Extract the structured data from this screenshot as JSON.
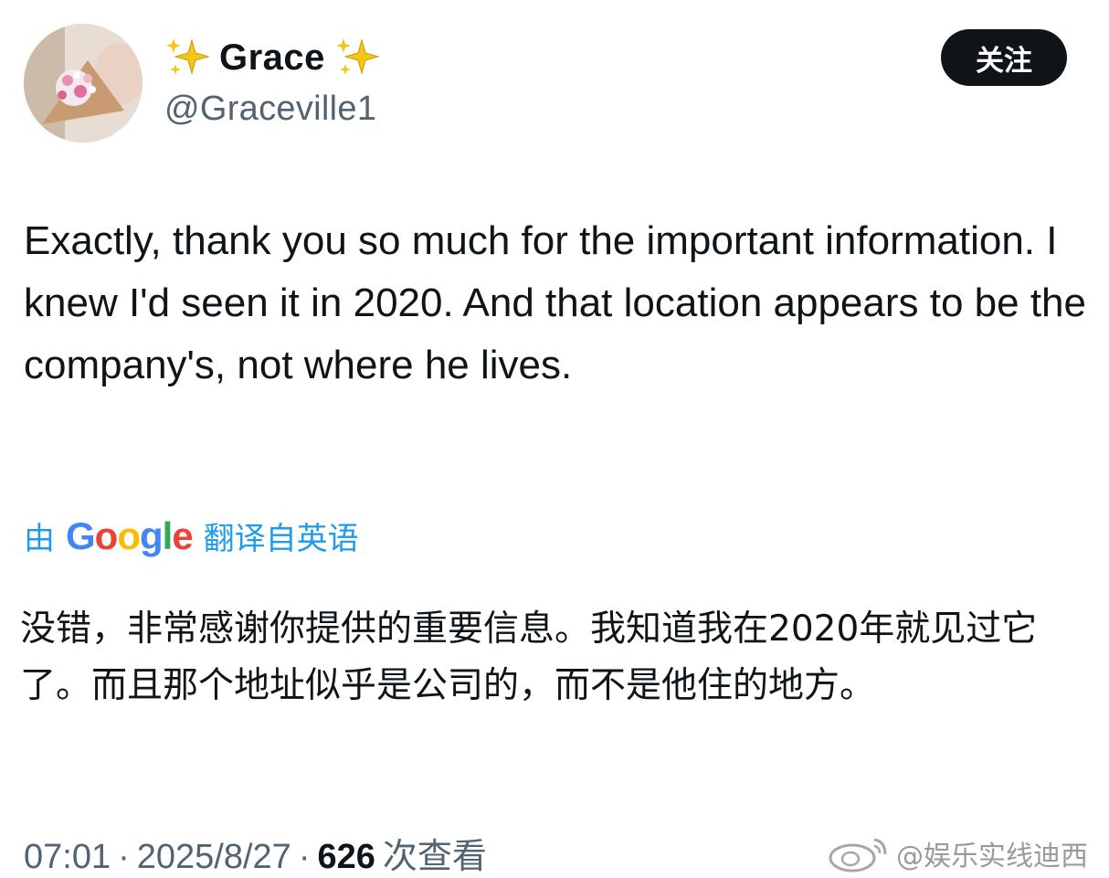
{
  "user": {
    "display_name": "Grace",
    "handle": "@Graceville1",
    "avatar_icon": "profile-photo-flowers"
  },
  "follow_button": {
    "label": "关注"
  },
  "tweet": {
    "text": "Exactly, thank you so much for the important information. I knew I'd seen it in 2020. And that location appears to be the company's, not where he lives."
  },
  "translation": {
    "by_label": "由",
    "provider_letters": [
      "G",
      "o",
      "o",
      "g",
      "l",
      "e"
    ],
    "from_label": "翻译自英语",
    "text": "没错，非常感谢你提供的重要信息。我知道我在2020年就见过它了。而且那个地址似乎是公司的，而不是他住的地方。"
  },
  "meta": {
    "time": "07:01",
    "separator": "·",
    "date": "2025/8/27",
    "views": "626",
    "views_label": "次查看"
  },
  "watermark": {
    "text": "@娱乐实线迪西",
    "icon": "weibo-logo-icon"
  },
  "colors": {
    "link_blue": "#1d9bf0",
    "text_primary": "#0f1419",
    "text_secondary": "#536471",
    "button_bg": "#0f1419"
  }
}
